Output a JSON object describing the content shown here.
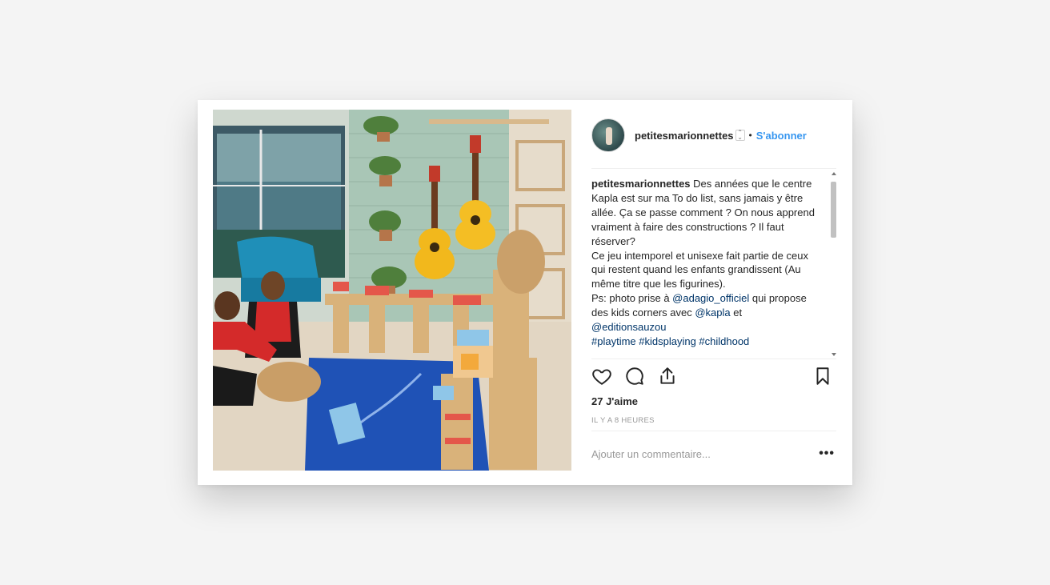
{
  "post": {
    "username": "petitesmarionnettes",
    "separator": "•",
    "follow_label": "S'abonner",
    "caption": {
      "user": "petitesmarionnettes",
      "text1": " Des années que le centre Kapla est sur ma To do list, sans jamais y être allée. Ça se passe comment ? On nous apprend vraiment à faire des constructions ? Il faut réserver?",
      "text2": "Ce jeu intemporel et unisexe fait partie de ceux qui restent quand les enfants grandissent (Au même titre que les figurines).",
      "text3": "Ps: photo prise à ",
      "mention1": "@adagio_officiel",
      "text4": " qui propose des kids corners avec ",
      "mention2": "@kapla",
      "text5": " et ",
      "mention3": "@editionsauzou",
      "hashtags": "#playtime #kidsplaying #childhood"
    },
    "likes": "27 J'aime",
    "time_ago": "IL Y A 8 HEURES",
    "comment_placeholder": "Ajouter un commentaire...",
    "more_label": "•••"
  },
  "icons": {
    "like": "heart-icon",
    "comment": "comment-icon",
    "share": "share-icon",
    "save": "bookmark-icon",
    "verified": "sort-arrows-icon"
  },
  "colors": {
    "link": "#3897f0",
    "mention": "#003569",
    "text": "#262626",
    "muted": "#999999"
  }
}
